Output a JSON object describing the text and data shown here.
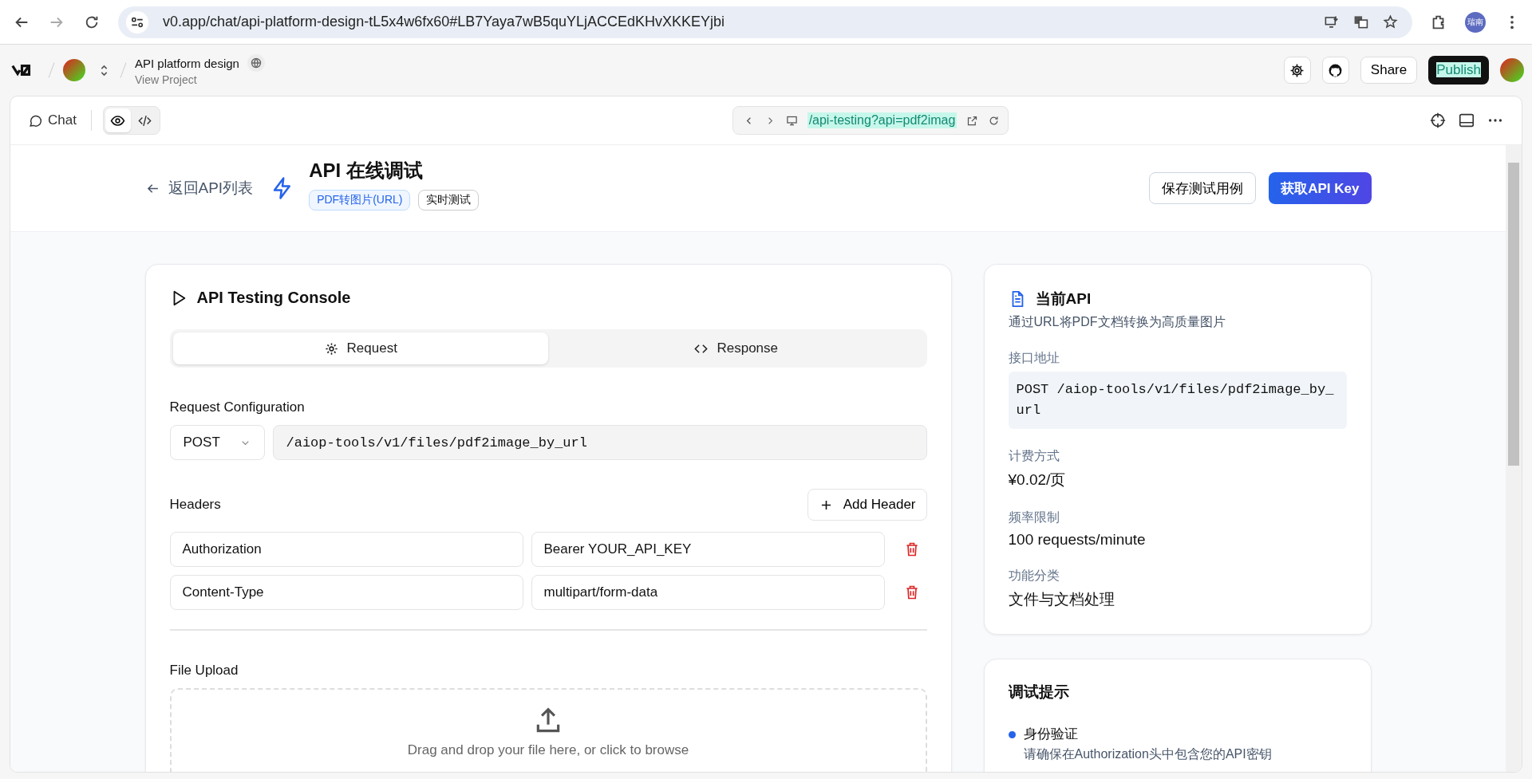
{
  "browser": {
    "url": "v0.app/chat/api-platform-design-tL5x4w6fx60#LB7Yaya7wB5quYLjACCEdKHvXKKEYjbi",
    "profile": "瑞南"
  },
  "project": {
    "name": "API platform design",
    "subtitle": "View Project"
  },
  "header_actions": {
    "share": "Share",
    "publish": "Publish"
  },
  "toolbar": {
    "chat": "Chat",
    "view_modes": [
      {
        "kind": "preview",
        "selected": true
      },
      {
        "kind": "code",
        "selected": false
      }
    ],
    "preview_url": "/api-testing?api=pdf2imag"
  },
  "page_header": {
    "back": "返回API列表",
    "title": "API 在线调试",
    "tags": [
      {
        "label": "PDF转图片(URL)",
        "kind": "primary"
      },
      {
        "label": "实时测试",
        "kind": "outline"
      }
    ],
    "save": "保存测试用例",
    "get_key": "获取API Key"
  },
  "console": {
    "title": "API Testing Console",
    "tabs": [
      {
        "label": "Request",
        "selected": true
      },
      {
        "label": "Response",
        "selected": false
      }
    ],
    "config": {
      "label": "Request Configuration",
      "method": "POST",
      "endpoint": "/aiop-tools/v1/files/pdf2image_by_url"
    },
    "headers": {
      "label": "Headers",
      "add": "Add Header",
      "rows": [
        {
          "key": "Authorization",
          "value": "Bearer YOUR_API_KEY"
        },
        {
          "key": "Content-Type",
          "value": "multipart/form-data"
        }
      ]
    },
    "upload": {
      "label": "File Upload",
      "hint": "Drag and drop your file here, or click to browse"
    }
  },
  "api_info": {
    "title": "当前API",
    "description": "通过URL将PDF文档转换为高质量图片",
    "fields": [
      {
        "label": "接口地址",
        "value": "POST /aiop-tools/v1/files/pdf2image_by_url",
        "kind": "code"
      },
      {
        "label": "计费方式",
        "value": "¥0.02/页",
        "kind": "text"
      },
      {
        "label": "频率限制",
        "value": "100 requests/minute",
        "kind": "text"
      },
      {
        "label": "功能分类",
        "value": "文件与文档处理",
        "kind": "text"
      }
    ]
  },
  "tips": {
    "title": "调试提示",
    "items": [
      {
        "title": "身份验证",
        "text": "请确保在Authorization头中包含您的API密钥"
      }
    ]
  }
}
